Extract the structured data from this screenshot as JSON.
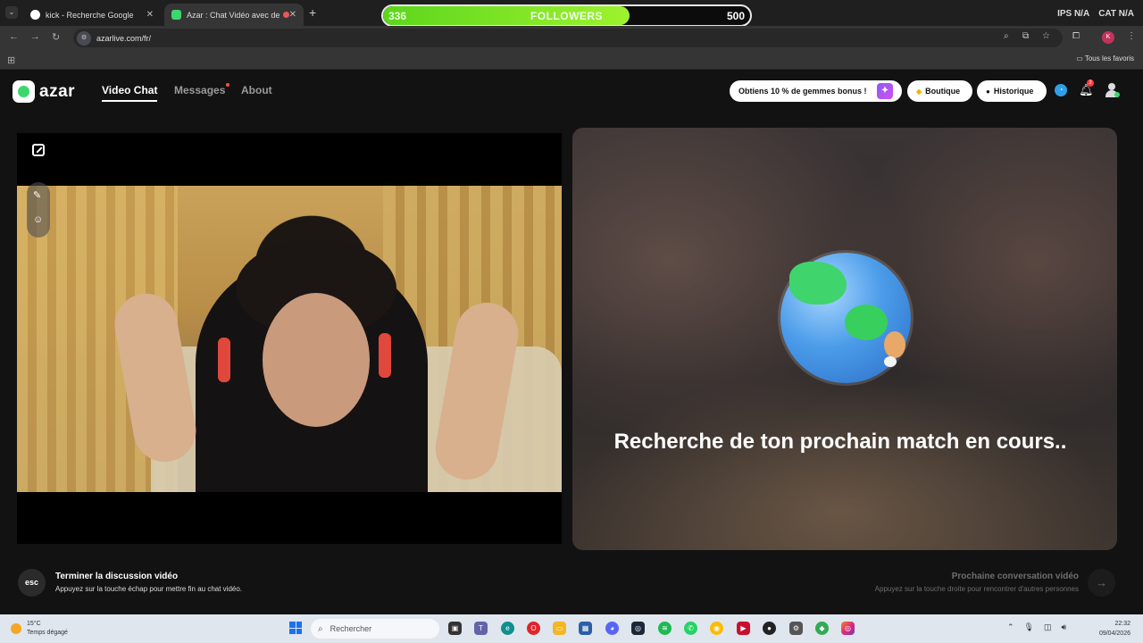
{
  "browser": {
    "tabs": [
      {
        "title": "kick - Recherche Google",
        "active": false
      },
      {
        "title": "Azar : Chat Vidéo avec de n",
        "active": true
      }
    ],
    "url": "azarlive.com/fr/",
    "bookmarks_label": "Tous les favoris",
    "profile_initial": "K"
  },
  "followers_overlay": {
    "label": "FOLLOWERS",
    "current": "336",
    "goal": "500",
    "progress": 0.672,
    "fill_color": "#7ee326"
  },
  "stream_stats": [
    "IPS N/A",
    "CAT N/A"
  ],
  "azar": {
    "logo": "azar",
    "nav": {
      "video_chat": "Video Chat",
      "messages": "Messages",
      "about": "About"
    },
    "promo": "Obtiens 10 % de gemmes bonus !",
    "shop": "Boutique",
    "history": "Historique",
    "notifications_badge": "2",
    "searching_text": "Recherche de ton prochain match en cours..",
    "footer": {
      "esc_key": "esc",
      "end_title": "Terminer la discussion vidéo",
      "end_sub": "Appuyez sur la touche échap pour mettre fin au chat vidéo.",
      "next_title": "Prochaine conversation vidéo",
      "next_sub": "Appuyez sur la touche droite pour rencontrer d'autres personnes"
    }
  },
  "taskbar": {
    "weather_temp": "15°C",
    "weather_desc": "Temps dégagé",
    "search_placeholder": "Rechercher",
    "time": "22:32",
    "date": "09/04/2026"
  },
  "colors": {
    "accent_green": "#3cd86e",
    "page_bg": "#121212"
  }
}
